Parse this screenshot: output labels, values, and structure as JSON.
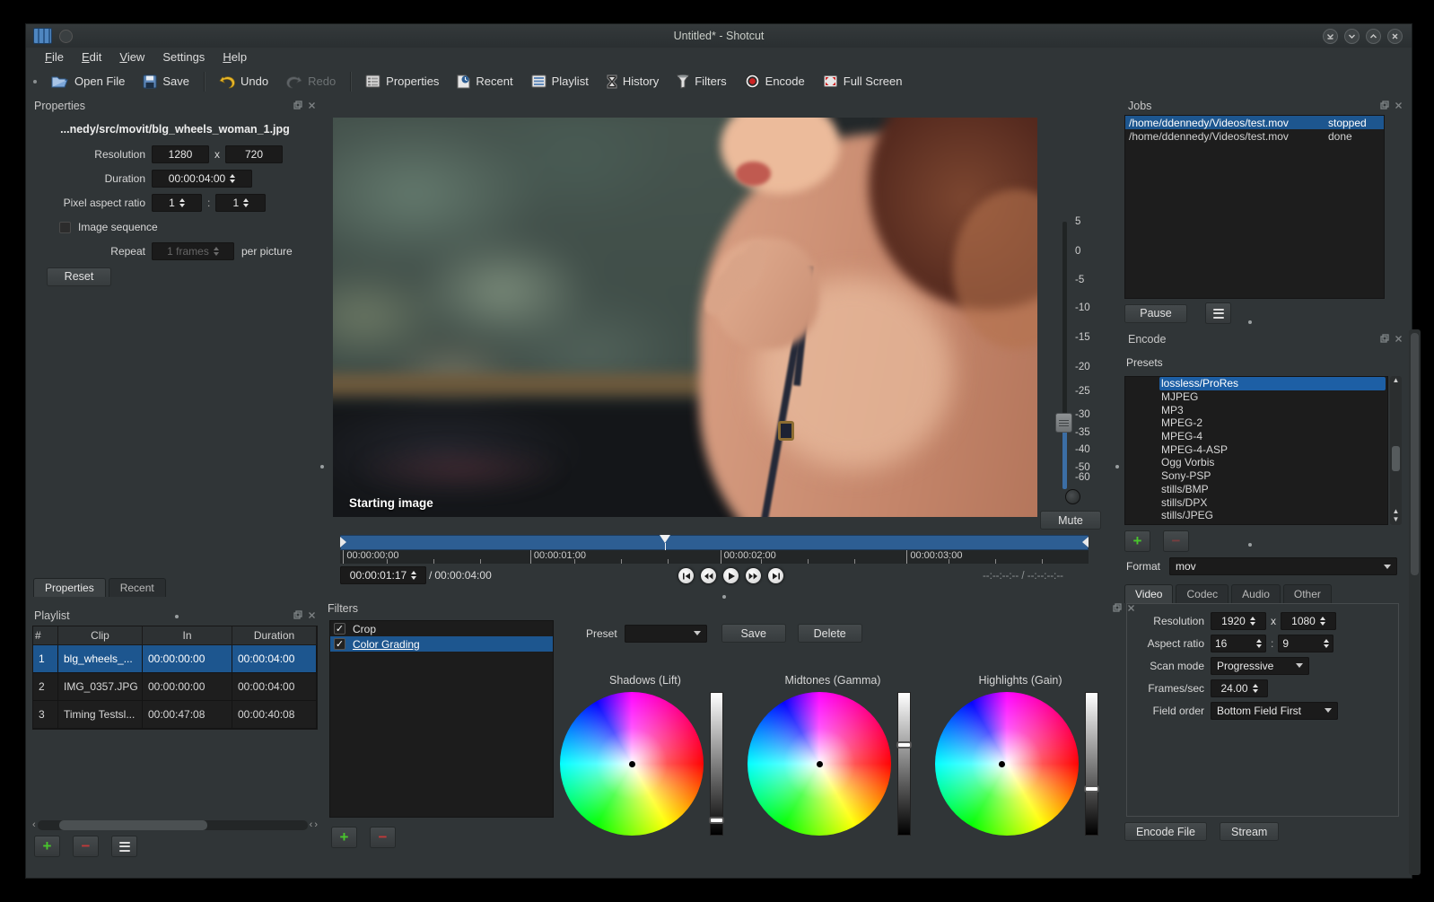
{
  "colors": {
    "selection_blue": "#1d568f",
    "timeline_blue": "#2d5e93",
    "add_green": "#49c62d",
    "remove_red": "#c03a3a",
    "window_bg": "#303537"
  },
  "icons": [
    "app-icon",
    "open-file-icon",
    "save-icon",
    "undo-icon",
    "redo-icon",
    "properties-icon",
    "recent-icon",
    "playlist-icon",
    "history-icon",
    "filters-icon",
    "encode-icon",
    "full-screen-icon",
    "float-panel-icon",
    "close-panel-icon",
    "plus-icon",
    "minus-icon",
    "menu-hamburger-icon",
    "speaker-icon",
    "shade-icon",
    "minimize-icon",
    "maximize-icon",
    "close-icon"
  ],
  "titlebar": {
    "title": "Untitled* - Shotcut"
  },
  "menu": {
    "items": [
      {
        "label": "File",
        "underline": true
      },
      {
        "label": "Edit",
        "underline": true
      },
      {
        "label": "View",
        "underline": true
      },
      {
        "label": "Settings",
        "underline": false
      },
      {
        "label": "Help",
        "underline": true
      }
    ]
  },
  "toolbar": {
    "buttons": [
      "Open File",
      "Save",
      "Undo",
      "Redo",
      "Properties",
      "Recent",
      "Playlist",
      "History",
      "Filters",
      "Encode",
      "Full Screen"
    ]
  },
  "properties_panel": {
    "title": "Properties",
    "filename": "...nedy/src/movit/blg_wheels_woman_1.jpg",
    "resolution_label": "Resolution",
    "resolution_width": "1280",
    "times_x": "x",
    "resolution_height": "720",
    "duration_label": "Duration",
    "duration_value": "00:00:04:00",
    "pixel_aspect_label": "Pixel aspect ratio",
    "pixel_aspect_num": "1",
    "ratio_colon": ":",
    "pixel_aspect_den": "1",
    "image_sequence_label": "Image sequence",
    "image_sequence_checked": false,
    "repeat_label": "Repeat",
    "repeat_value": "1 frames",
    "repeat_suffix": "per picture",
    "reset_label": "Reset"
  },
  "side_tabs": {
    "tabs": [
      "Properties",
      "Recent"
    ],
    "active_index": 0
  },
  "playlist_panel": {
    "title": "Playlist",
    "columns": [
      "#",
      "Clip",
      "In",
      "Duration"
    ],
    "rows": [
      [
        "1",
        "blg_wheels_...",
        "00:00:00:00",
        "00:00:04:00"
      ],
      [
        "2",
        "IMG_0357.JPG",
        "00:00:00:00",
        "00:00:04:00"
      ],
      [
        "3",
        "Timing Testsl...",
        "00:00:47:08",
        "00:00:40:08"
      ]
    ],
    "selected_index": 0
  },
  "preview": {
    "overlay_text": "Starting image"
  },
  "volume": {
    "scale_labels": [
      "5",
      "0",
      "-5",
      "-10",
      "-15",
      "-20",
      "-25",
      "-30",
      "-35",
      "-40",
      "-50",
      "-60"
    ],
    "mute_label": "Mute",
    "slider_position": 0.76
  },
  "transport": {
    "position": "00:00:01:17",
    "separator": "/",
    "duration": "00:00:04:00",
    "selection_range": "--:--:--:-- / --:--:--:--",
    "ruler_ticks": [
      "00:00:00:00",
      "00:00:01:00",
      "00:00:02:00",
      "00:00:03:00"
    ],
    "playhead_fraction": 0.434
  },
  "filters_panel": {
    "title": "Filters",
    "items": [
      {
        "label": "Crop",
        "checked": true,
        "selected": false
      },
      {
        "label": "Color Grading",
        "checked": true,
        "selected": true
      }
    ],
    "preset_label": "Preset",
    "preset_value": "",
    "save_label": "Save",
    "delete_label": "Delete",
    "wheels": [
      {
        "label": "Shadows (Lift)",
        "slider_pos": 0.92
      },
      {
        "label": "Midtones (Gamma)",
        "slider_pos": 0.36
      },
      {
        "label": "Highlights (Gain)",
        "slider_pos": 0.69
      }
    ]
  },
  "jobs_panel": {
    "title": "Jobs",
    "jobs": [
      {
        "path": "/home/ddennedy/Videos/test.mov",
        "status": "stopped"
      },
      {
        "path": "/home/ddennedy/Videos/test.mov",
        "status": "done"
      }
    ],
    "selected_index": 0,
    "pause_label": "Pause"
  },
  "encode_panel": {
    "title": "Encode",
    "presets_label": "Presets",
    "presets": [
      "lossless/ProRes",
      "MJPEG",
      "MP3",
      "MPEG-2",
      "MPEG-4",
      "MPEG-4-ASP",
      "Ogg Vorbis",
      "Sony-PSP",
      "stills/BMP",
      "stills/DPX",
      "stills/JPEG"
    ],
    "selected_index": 0,
    "format_label": "Format",
    "format_value": "mov",
    "tabs": [
      "Video",
      "Codec",
      "Audio",
      "Other"
    ],
    "active_tab": 0,
    "resolution_label": "Resolution",
    "resolution_width": "1920",
    "times_x": "x",
    "resolution_height": "1080",
    "aspect_label": "Aspect ratio",
    "aspect_num": "16",
    "ratio_colon": ":",
    "aspect_den": "9",
    "scan_label": "Scan mode",
    "scan_value": "Progressive",
    "fps_label": "Frames/sec",
    "fps_value": "24.00",
    "field_label": "Field order",
    "field_value": "Bottom Field First",
    "encode_file_label": "Encode File",
    "stream_label": "Stream"
  }
}
